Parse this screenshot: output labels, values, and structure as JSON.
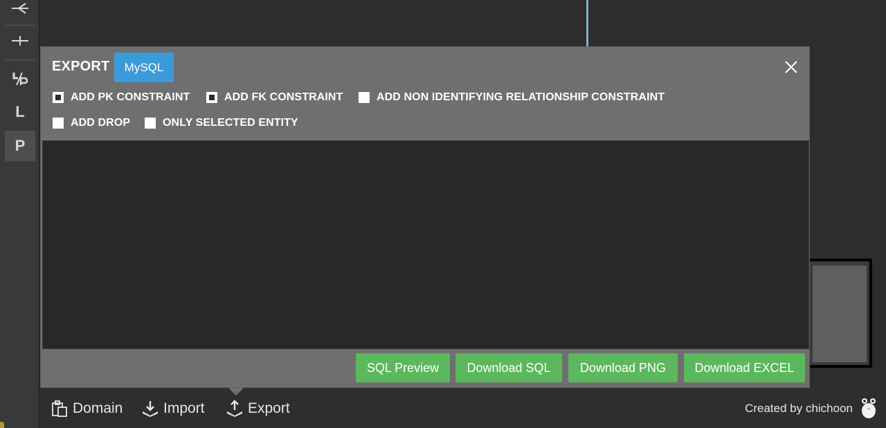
{
  "toolbar": {
    "tools": [
      {
        "name": "relationship-one-many-icon",
        "glyph": "⊣"
      },
      {
        "name": "relationship-one-one-icon",
        "glyph": "+"
      },
      {
        "name": "column-pk-fk-icon",
        "label": "ᒧ/P"
      },
      {
        "name": "logical-icon",
        "label": "L"
      },
      {
        "name": "physical-icon",
        "label": "P"
      }
    ]
  },
  "modal": {
    "title": "EXPORT",
    "db_type": "MySQL",
    "options": [
      {
        "label": "ADD PK CONSTRAINT",
        "checked": true
      },
      {
        "label": "ADD FK CONSTRAINT",
        "checked": true
      },
      {
        "label": "ADD NON IDENTIFYING RELATIONSHIP CONSTRAINT",
        "checked": false
      },
      {
        "label": "ADD DROP",
        "checked": false
      },
      {
        "label": "ONLY SELECTED ENTITY",
        "checked": false
      }
    ],
    "sql_text": "",
    "buttons": {
      "sql_preview": "SQL Preview",
      "download_sql": "Download SQL",
      "download_png": "Download PNG",
      "download_excel": "Download EXCEL"
    }
  },
  "bottombar": {
    "domain": "Domain",
    "import": "Import",
    "export": "Export",
    "credit": "Created by chichoon"
  },
  "colors": {
    "accent_blue": "#3b9ad9",
    "button_green": "#5cb85c",
    "modal_bg": "#6f6f6f"
  }
}
